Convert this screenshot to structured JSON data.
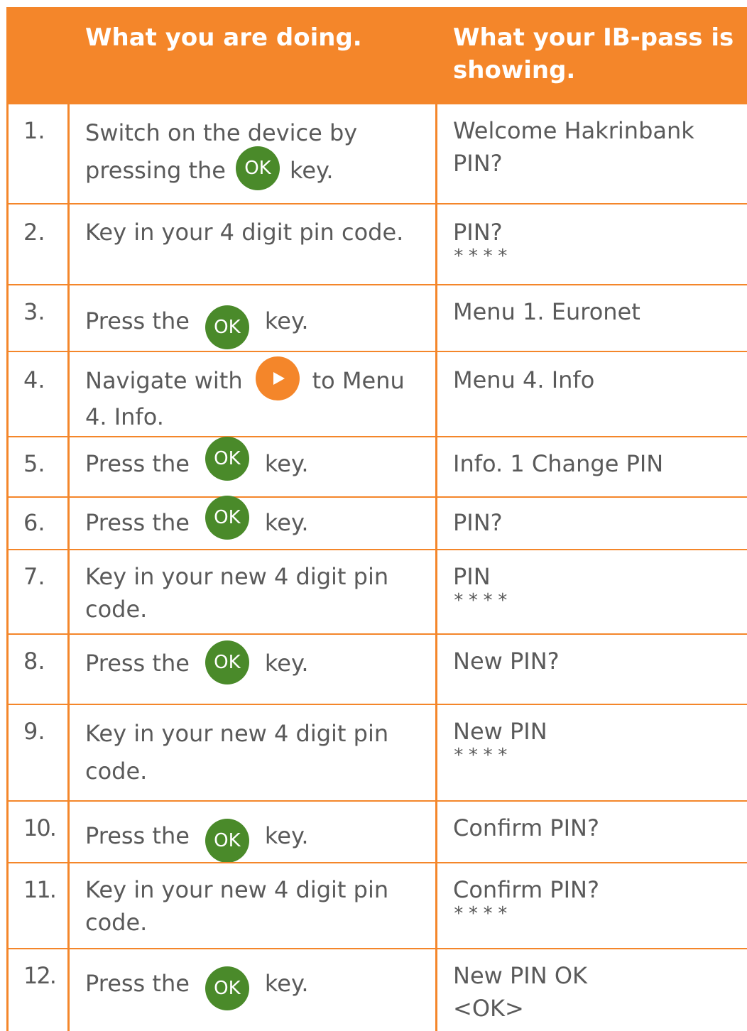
{
  "header": {
    "col_action": "What you are doing.",
    "col_display": "What your IB-pass is showing."
  },
  "ok_label": "OK",
  "rows": [
    {
      "num": "1.",
      "action_before": "Switch on the device by pressing the",
      "action_after": "key.",
      "display": "Welcome Hakrinbank PIN?",
      "stars": ""
    },
    {
      "num": "2.",
      "action_before": "Key in your 4 digit pin code.",
      "action_after": "",
      "display": "PIN?",
      "stars": "****"
    },
    {
      "num": "3.",
      "action_before": "Press the",
      "action_after": "key.",
      "display": "Menu 1. Euronet",
      "stars": ""
    },
    {
      "num": "4.",
      "action_before": "Navigate with",
      "action_after": "to Menu 4. Info.",
      "display": "Menu 4. Info",
      "stars": ""
    },
    {
      "num": "5.",
      "action_before": "Press the",
      "action_after": "key.",
      "display": "Info. 1 Change PIN",
      "stars": ""
    },
    {
      "num": "6.",
      "action_before": "Press the",
      "action_after": "key.",
      "display": "PIN?",
      "stars": ""
    },
    {
      "num": "7.",
      "action_before": "Key in your new 4 digit pin code.",
      "action_after": "",
      "display": "PIN",
      "stars": "****"
    },
    {
      "num": "8.",
      "action_before": "Press the",
      "action_after": "key.",
      "display": "New PIN?",
      "stars": ""
    },
    {
      "num": "9.",
      "action_before": "Key in your new 4 digit pin code.",
      "action_after": "",
      "display": "New PIN",
      "stars": "****"
    },
    {
      "num": "10.",
      "action_before": "Press the",
      "action_after": "key.",
      "display": "Confirm PIN?",
      "stars": ""
    },
    {
      "num": "11.",
      "action_before": "Key in your new 4 digit pin code.",
      "action_after": "",
      "display": "Confirm PIN?",
      "stars": "****"
    },
    {
      "num": "12.",
      "action_before": "Press the",
      "action_after": "key.",
      "display": "New PIN OK <OK>",
      "stars": ""
    }
  ],
  "colors": {
    "accent": "#f4862a",
    "ok_button": "#4a8a2a",
    "text": "#5a5a5a"
  }
}
